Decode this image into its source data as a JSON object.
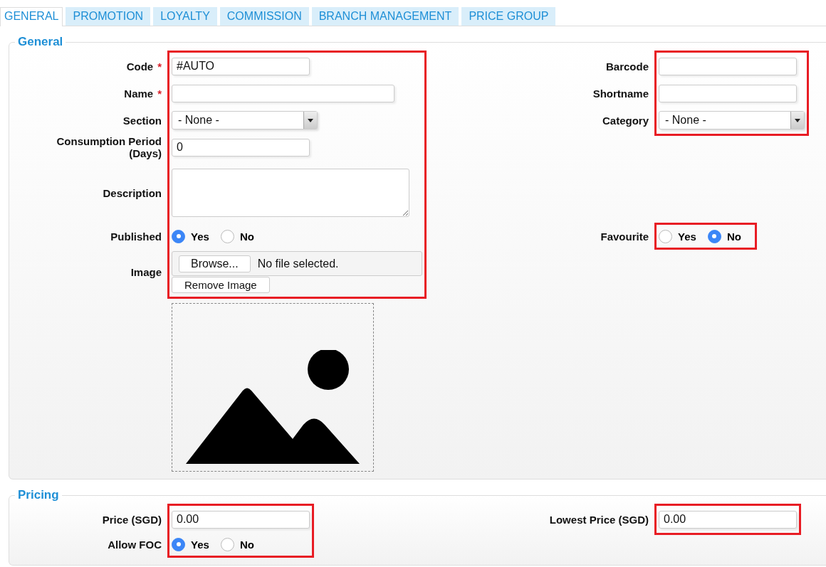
{
  "tabs": [
    {
      "label": "GENERAL",
      "selected": true
    },
    {
      "label": "PROMOTION",
      "selected": false
    },
    {
      "label": "LOYALTY",
      "selected": false
    },
    {
      "label": "COMMISSION",
      "selected": false
    },
    {
      "label": "BRANCH MANAGEMENT",
      "selected": false
    },
    {
      "label": "PRICE GROUP",
      "selected": false
    }
  ],
  "general": {
    "legend": "General",
    "left_group": {
      "highlighted": true,
      "fields": [
        {
          "kind": "text",
          "label": "Code",
          "required_mark": "*",
          "value": "#AUTO"
        },
        {
          "kind": "text",
          "label": "Name",
          "required_mark": "*",
          "wide": true
        },
        {
          "kind": "select",
          "label": "Section",
          "value": "- None -"
        },
        {
          "kind": "text",
          "label": "Consumption Period (Days)",
          "value": "0"
        },
        {
          "kind": "textarea",
          "label": "Description"
        },
        {
          "kind": "radio",
          "label": "Published",
          "options": [
            {
              "label": "Yes",
              "selected": true
            },
            {
              "label": "No",
              "selected": false
            }
          ]
        },
        {
          "kind": "file",
          "label": "Image",
          "browse_button": "Browse...",
          "file_status": "No file selected.",
          "remove_button": "Remove Image"
        }
      ]
    },
    "right_group": {
      "highlighted": true,
      "fields": [
        {
          "kind": "text",
          "label": "Barcode"
        },
        {
          "kind": "text",
          "label": "Shortname"
        },
        {
          "kind": "select",
          "label": "Category",
          "value": "- None -"
        }
      ]
    },
    "favourite_group": {
      "highlighted": true,
      "fields": [
        {
          "kind": "radio",
          "label": "Favourite",
          "options": [
            {
              "label": "Yes",
              "selected": false
            },
            {
              "label": "No",
              "selected": true
            }
          ]
        }
      ]
    }
  },
  "pricing": {
    "legend": "Pricing",
    "left_group": {
      "highlighted": true,
      "fields": [
        {
          "kind": "text",
          "label": "Price (SGD)",
          "value": "0.00"
        },
        {
          "kind": "radio",
          "label": "Allow FOC",
          "options": [
            {
              "label": "Yes",
              "selected": true
            },
            {
              "label": "No",
              "selected": false
            }
          ]
        }
      ]
    },
    "right_group": {
      "highlighted": true,
      "fields": [
        {
          "kind": "text",
          "label": "Lowest Price (SGD)",
          "value": "0.00"
        }
      ]
    }
  }
}
